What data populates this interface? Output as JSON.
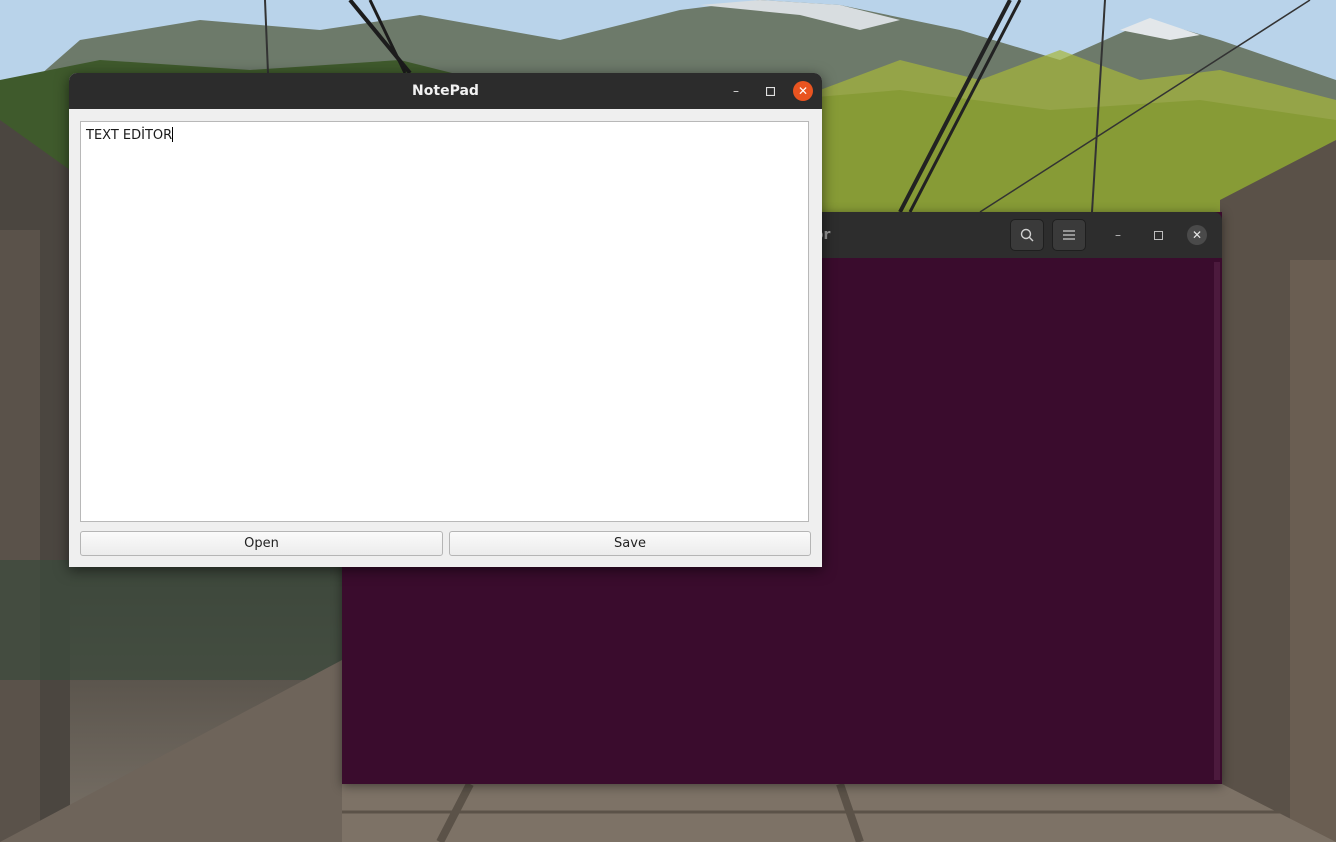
{
  "notepad": {
    "title": "NotePad",
    "minimize_glyph": "–",
    "maximize_glyph": "▫",
    "close_glyph": "✕",
    "text_content": "TEXT EDİTOR",
    "open_label": "Open",
    "save_label": "Save"
  },
  "terminal": {
    "title_visible": "sktop/Editor",
    "search_icon": "search-icon",
    "menu_icon": "hamburger-menu-icon",
    "minimize_glyph": "–",
    "maximize_glyph": "▫",
    "close_glyph": "✕"
  },
  "colors": {
    "terminal_bg": "#3a0c2d",
    "close_accent": "#e95420",
    "titlebar": "#2c2c2c"
  }
}
